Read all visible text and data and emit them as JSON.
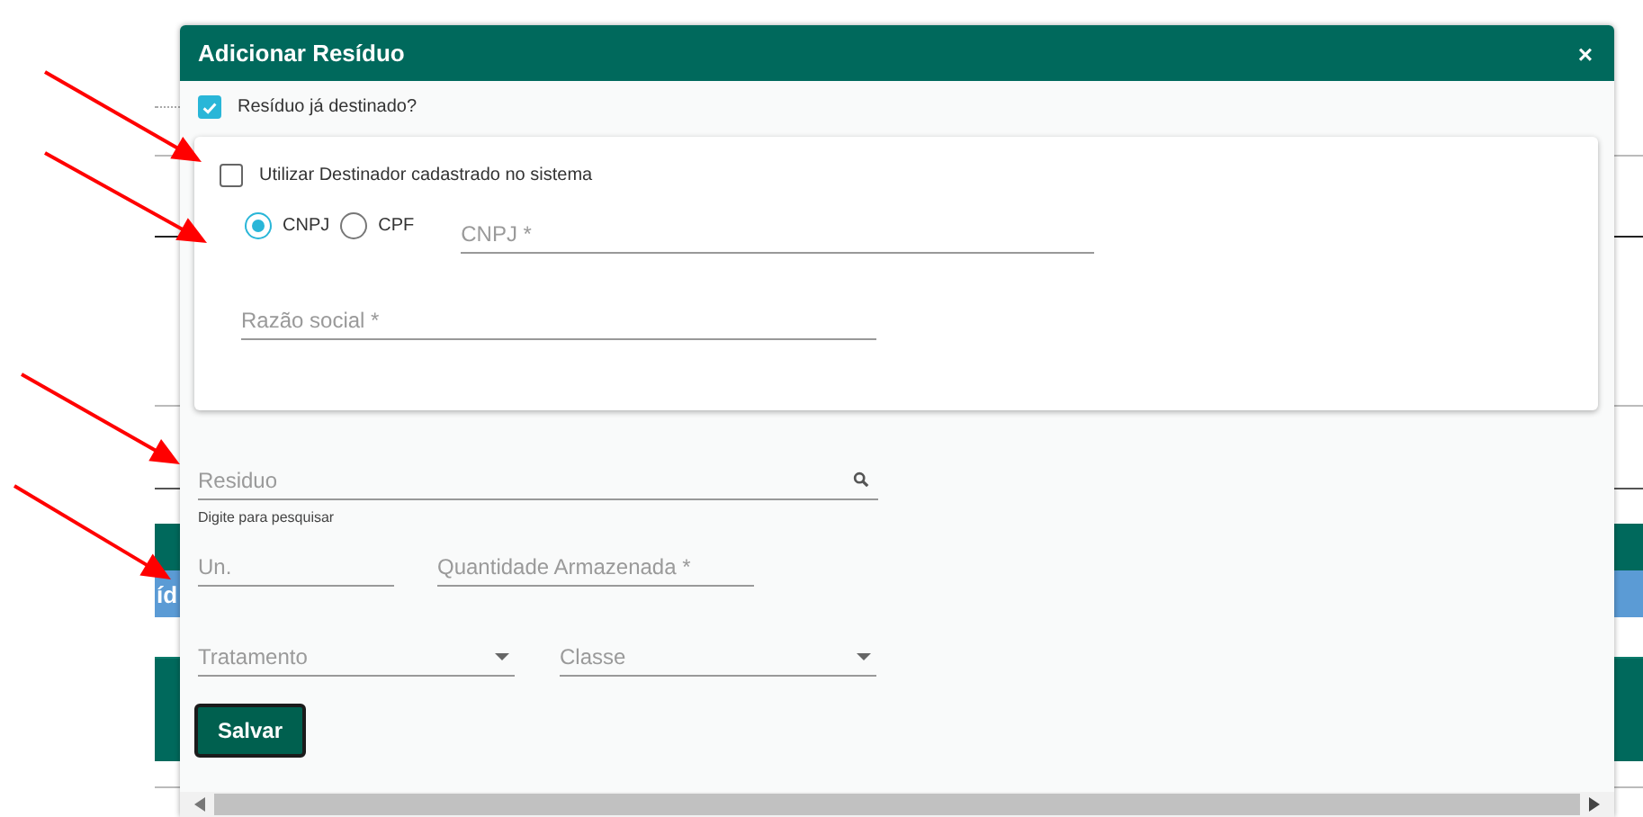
{
  "background": {
    "row_text": "íd"
  },
  "dialog": {
    "title": "Adicionar Resíduo",
    "close": "×",
    "already_disposed": {
      "label": "Resíduo já destinado?",
      "checked": true
    },
    "destination": {
      "use_registered": {
        "label": "Utilizar Destinador cadastrado no sistema",
        "checked": false
      },
      "doc_types": [
        {
          "label": "CNPJ",
          "selected": true
        },
        {
          "label": "CPF",
          "selected": false
        }
      ],
      "document": {
        "placeholder": "CNPJ *"
      },
      "company_name": {
        "placeholder": "Razão social *"
      }
    },
    "residue": {
      "placeholder": "Residuo",
      "hint": "Digite para pesquisar"
    },
    "unit": {
      "placeholder": "Un."
    },
    "quantity": {
      "placeholder": "Quantidade Armazenada *"
    },
    "treatment": {
      "placeholder": "Tratamento"
    },
    "class": {
      "placeholder": "Classe"
    },
    "save_button": "Salvar"
  }
}
